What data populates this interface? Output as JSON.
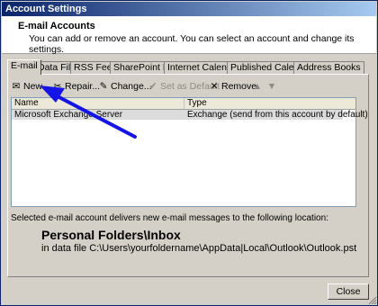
{
  "window": {
    "title": "Account Settings"
  },
  "header": {
    "title": "E-mail Accounts",
    "subtitle": "You can add or remove an account. You can select an account and change its settings."
  },
  "tabs": [
    {
      "label": "E-mail",
      "active": true
    },
    {
      "label": "Data Files",
      "active": false
    },
    {
      "label": "RSS Feeds",
      "active": false
    },
    {
      "label": "SharePoint Lists",
      "active": false
    },
    {
      "label": "Internet Calendars",
      "active": false
    },
    {
      "label": "Published Calendars",
      "active": false
    },
    {
      "label": "Address Books",
      "active": false
    }
  ],
  "toolbar": {
    "new_label": "New...",
    "repair_label": "Repair...",
    "change_label": "Change...",
    "set_default_label": "Set as Default",
    "remove_label": "Remove"
  },
  "list": {
    "columns": [
      "Name",
      "Type"
    ],
    "rows": [
      {
        "name": "Microsoft Exchange Server",
        "type": "Exchange (send from this account by default)"
      }
    ]
  },
  "delivery": {
    "note": "Selected e-mail account delivers new e-mail messages to the following location:",
    "folder": "Personal Folders\\Inbox",
    "path": "in data file C:\\Users\\yourfoldername\\AppData|Local\\Outlook\\Outlook.pst"
  },
  "footer": {
    "close_label": "Close"
  },
  "colors": {
    "annotation_arrow": "#1414e6",
    "title_bar": "#0a246a"
  }
}
